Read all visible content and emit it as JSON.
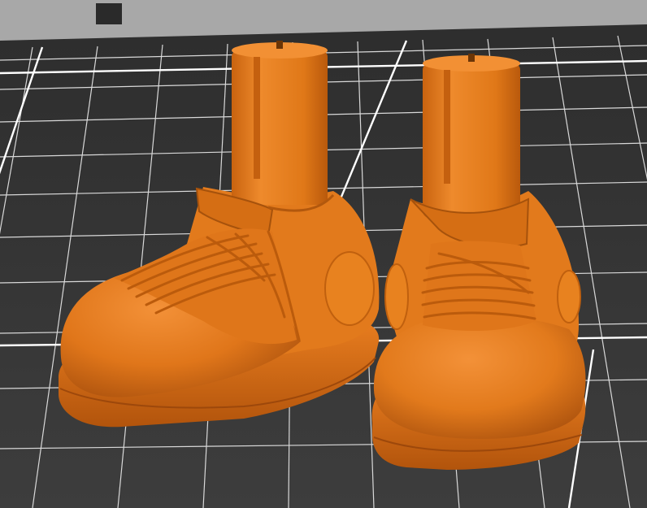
{
  "viewport": {
    "view_mode": "3d-preview",
    "colors": {
      "background_far": "#a9a9a9",
      "gantry_dark": "#2b2b2b",
      "bed": "#3b3b3b",
      "bed_dark": "#303030",
      "grid_line": "#d8d8d8",
      "grid_line_major": "#ffffff",
      "model": "#e0761a",
      "model_light": "#f08a2a",
      "model_shadow": "#b8570e",
      "model_deep": "#8f4208"
    }
  },
  "model": {
    "name_visible": "",
    "parts": [
      "left-shoe",
      "right-shoe"
    ]
  }
}
